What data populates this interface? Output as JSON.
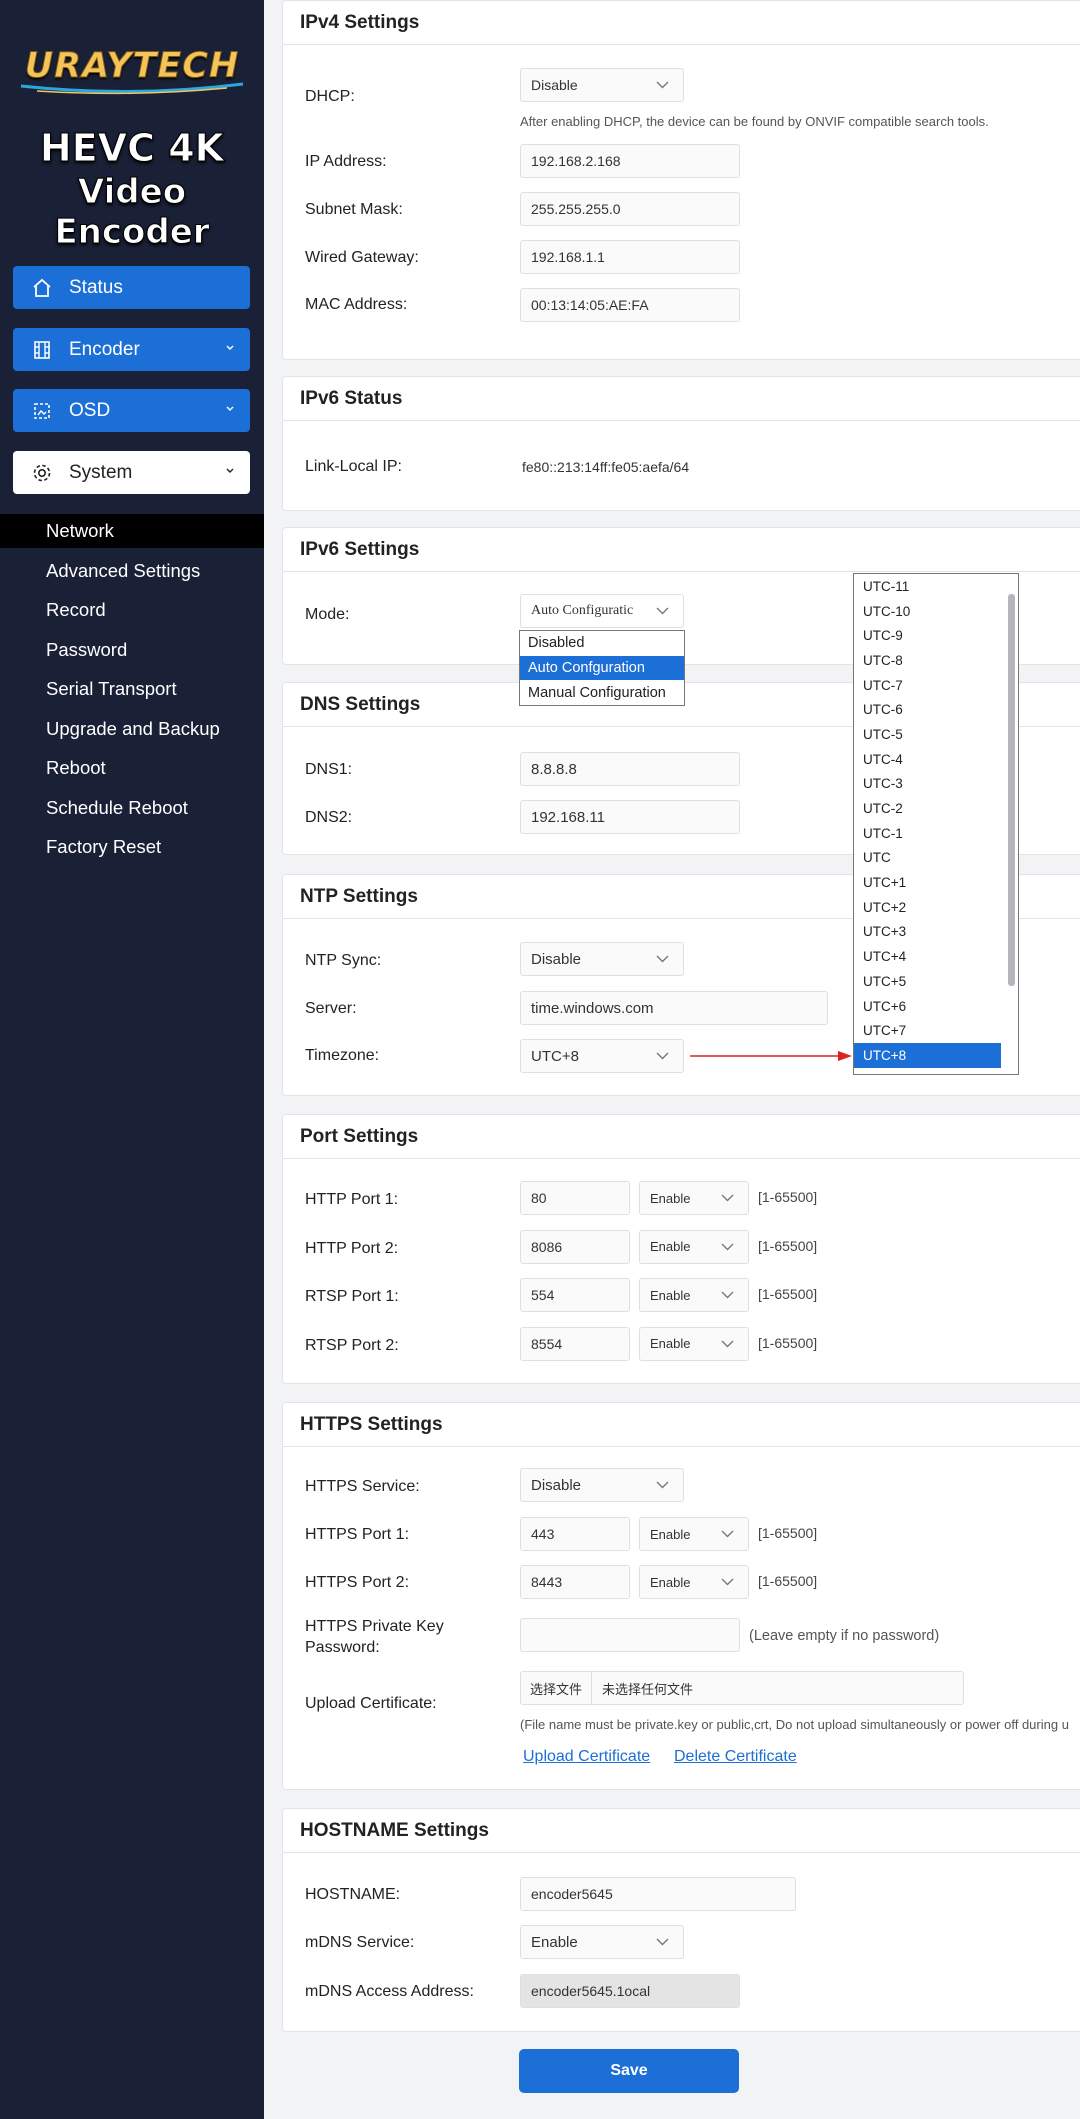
{
  "brand": {
    "logo": "URAYTECH",
    "product_line1": "HEVC 4K",
    "product_line2": "Video Encoder"
  },
  "nav": {
    "status": "Status",
    "encoder": "Encoder",
    "osd": "OSD",
    "system": "System",
    "sub_items": [
      "Network",
      "Advanced Settings",
      "Record",
      "Password",
      "Serial Transport",
      "Upgrade and Backup",
      "Reboot",
      "Schedule Reboot",
      "Factory Reset"
    ]
  },
  "ipv4": {
    "title": "IPv4 Settings",
    "dhcp_label": "DHCP:",
    "dhcp_value": "Disable",
    "dhcp_hint": "After enabling DHCP, the device can be found by ONVIF compatible search tools.",
    "ip_label": "IP Address:",
    "ip_value": "192.168.2.168",
    "mask_label": "Subnet Mask:",
    "mask_value": "255.255.255.0",
    "gateway_label": "Wired Gateway:",
    "gateway_value": "192.168.1.1",
    "mac_label": "MAC Address:",
    "mac_value": "00:13:14:05:AE:FA"
  },
  "ipv6_status": {
    "title": "IPv6 Status",
    "link_label": "Link-Local IP:",
    "link_value": "fe80::213:14ff:fe05:aefa/64"
  },
  "ipv6": {
    "title": "IPv6 Settings",
    "mode_label": "Mode:",
    "mode_value": "Auto Configuratic",
    "mode_options": [
      "Disabled",
      "Auto Confguration",
      "Manual Configuration"
    ]
  },
  "dns": {
    "title": "DNS Settings",
    "dns1_label": "DNS1:",
    "dns1_value": "8.8.8.8",
    "dns2_label": "DNS2:",
    "dns2_value": "192.168.11"
  },
  "ntp": {
    "title": "NTP Settings",
    "sync_label": "NTP Sync:",
    "sync_value": "Disable",
    "server_label": "Server:",
    "server_value": "time.windows.com",
    "tz_label": "Timezone:",
    "tz_value": "UTC+8",
    "tz_options": [
      "UTC-11",
      "UTC-10",
      "UTC-9",
      "UTC-8",
      "UTC-7",
      "UTC-6",
      "UTC-5",
      "UTC-4",
      "UTC-3",
      "UTC-2",
      "UTC-1",
      "UTC",
      "UTC+1",
      "UTC+2",
      "UTC+3",
      "UTC+4",
      "UTC+5",
      "UTC+6",
      "UTC+7",
      "UTC+8"
    ]
  },
  "ports": {
    "title": "Port Settings",
    "rows": [
      {
        "label": "HTTP Port 1:",
        "value": "80",
        "state": "Enable",
        "range": "[1-65500]"
      },
      {
        "label": "HTTP Port 2:",
        "value": "8086",
        "state": "Enable",
        "range": "[1-65500]"
      },
      {
        "label": "RTSP Port 1:",
        "value": "554",
        "state": "Enable",
        "range": "[1-65500]"
      },
      {
        "label": "RTSP Port 2:",
        "value": "8554",
        "state": "Enable",
        "range": "[1-65500]"
      }
    ]
  },
  "https": {
    "title": "HTTPS Settings",
    "service_label": "HTTPS Service:",
    "service_value": "Disable",
    "port1_label": "HTTPS Port 1:",
    "port1_value": "443",
    "port1_state": "Enable",
    "port1_range": "[1-65500]",
    "port2_label": "HTTPS Port 2:",
    "port2_value": "8443",
    "port2_state": "Enable",
    "port2_range": "[1-65500]",
    "key_label_1": "HTTPS Private Key",
    "key_label_2": "Password:",
    "key_value": "",
    "key_hint": "(Leave empty if no password)",
    "upload_label": "Upload Certificate:",
    "file_button": "选择文件",
    "file_status": "未选择任何文件",
    "upload_hint": "(File name must be private.key or public,crt, Do not upload simultaneously or power off during u",
    "upload_link": "Upload Certificate",
    "delete_link": "Delete Certificate"
  },
  "hostname": {
    "title": "HOSTNAME Settings",
    "host_label": "HOSTNAME:",
    "host_value": "encoder5645",
    "mdns_label": "mDNS Service:",
    "mdns_value": "Enable",
    "mdns_addr_label": "mDNS Access Address:",
    "mdns_addr_value": "encoder5645.1ocal"
  },
  "save_label": "Save"
}
